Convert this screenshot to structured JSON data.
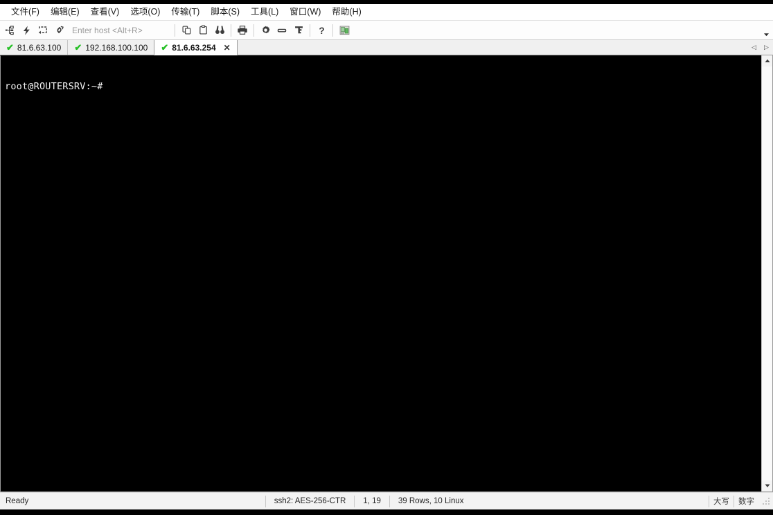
{
  "menubar": {
    "items": [
      {
        "label": "文件(F)",
        "name": "menu-file"
      },
      {
        "label": "编辑(E)",
        "name": "menu-edit"
      },
      {
        "label": "查看(V)",
        "name": "menu-view"
      },
      {
        "label": "选项(O)",
        "name": "menu-options"
      },
      {
        "label": "传输(T)",
        "name": "menu-transfer"
      },
      {
        "label": "脚本(S)",
        "name": "menu-script"
      },
      {
        "label": "工具(L)",
        "name": "menu-tools"
      },
      {
        "label": "窗口(W)",
        "name": "menu-window"
      },
      {
        "label": "帮助(H)",
        "name": "menu-help"
      }
    ]
  },
  "toolbar": {
    "host_placeholder": "Enter host <Alt+R>",
    "host_value": "",
    "icons": [
      "session-manager-icon",
      "quick-connect-icon",
      "reconnect-icon",
      "disconnect-icon",
      "copy-icon",
      "paste-icon",
      "find-icon",
      "print-icon",
      "settings-icon",
      "keyboard-icon",
      "key-icon",
      "help-icon",
      "image-icon"
    ],
    "overflow_label": "▾"
  },
  "tabs": [
    {
      "label": "81.6.63.100",
      "active": false,
      "status": "connected"
    },
    {
      "label": "192.168.100.100",
      "active": false,
      "status": "connected"
    },
    {
      "label": "81.6.63.254",
      "active": true,
      "status": "connected"
    }
  ],
  "tab_nav": {
    "prev": "◁",
    "next": "▷"
  },
  "terminal": {
    "lines": [
      "root@ROUTERSRV:~#"
    ],
    "background": "#000000",
    "foreground": "#f2f2f2"
  },
  "scrollbar": {
    "up": "⌃",
    "down": "⌄"
  },
  "statusbar": {
    "ready": "Ready",
    "cipher": "ssh2: AES-256-CTR",
    "cursor": "1, 19",
    "dimensions": "39 Rows, 10 Linux",
    "caps": "大写",
    "num": "数字"
  },
  "colors": {
    "accent_green": "#25c025",
    "terminal_bg": "#000000",
    "chrome_bg": "#f0f0f0"
  }
}
